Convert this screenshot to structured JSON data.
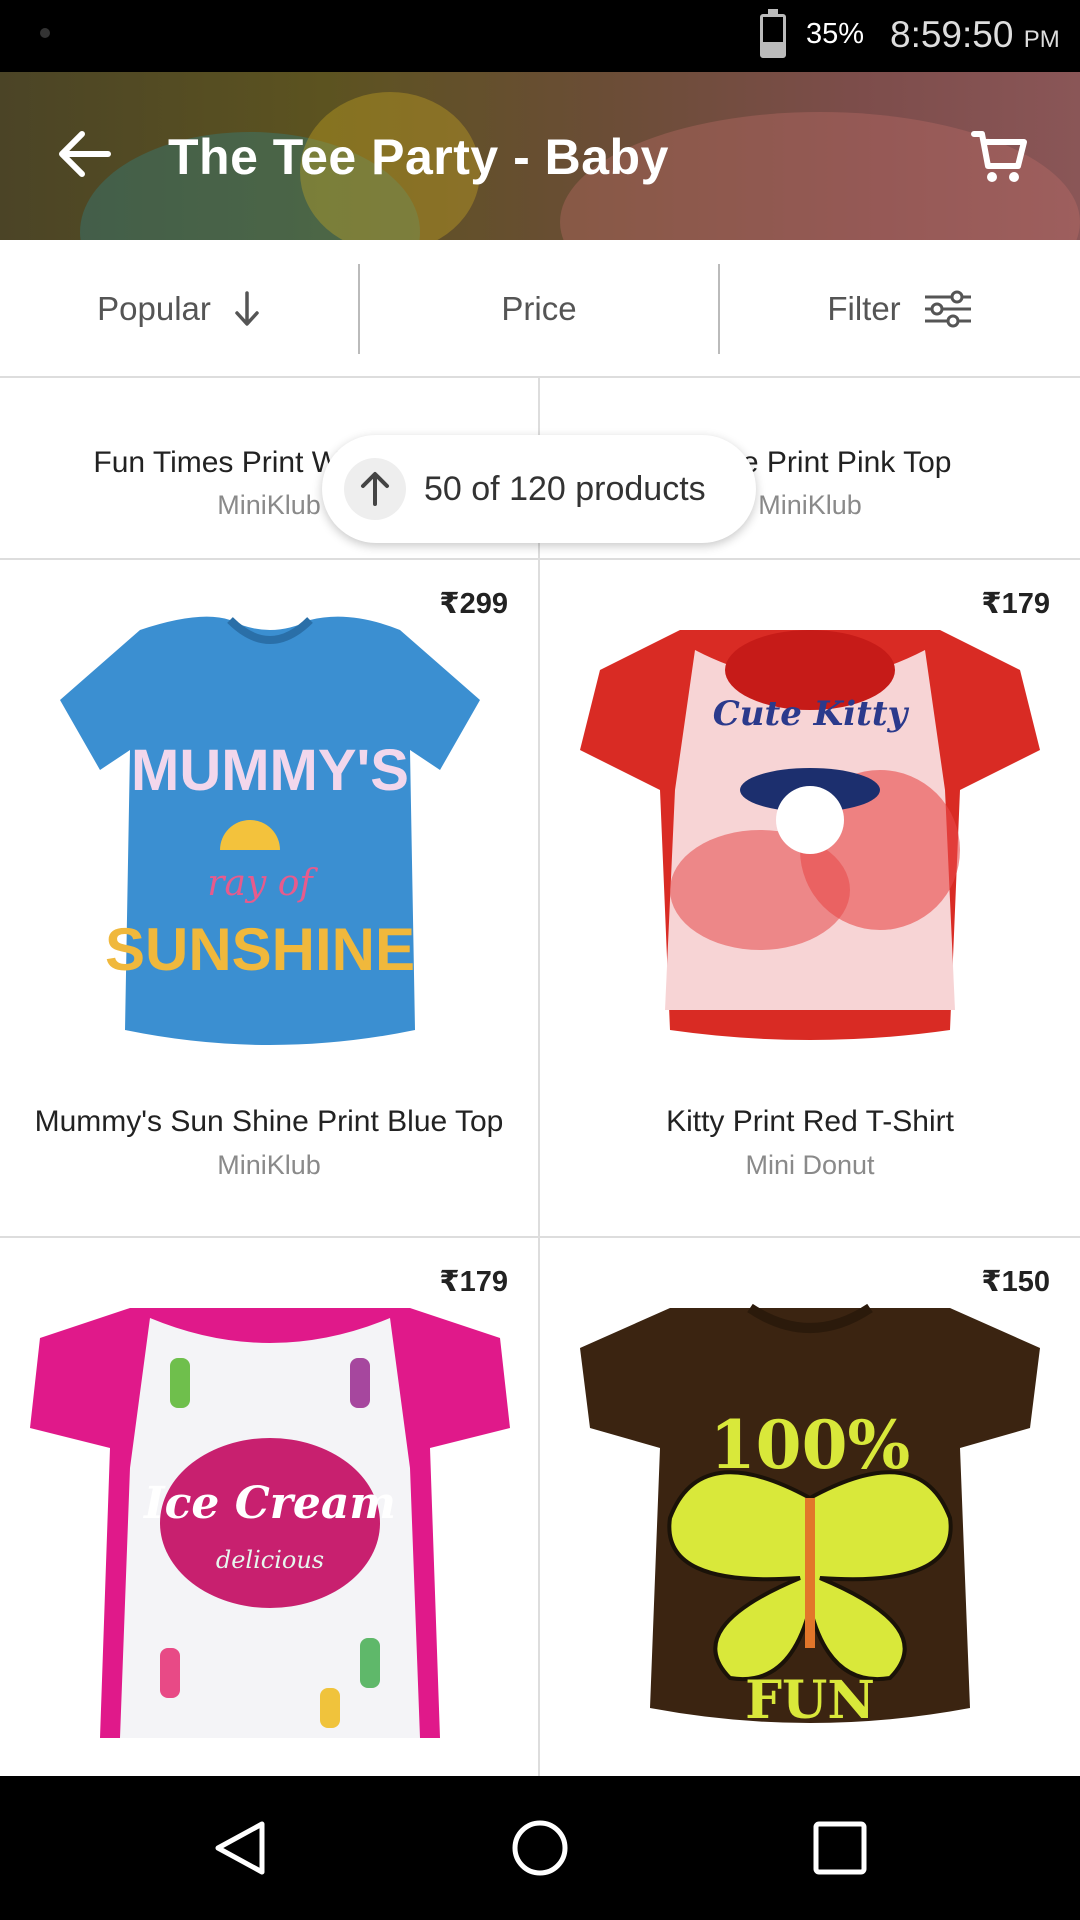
{
  "status_bar": {
    "battery_percent": "35%",
    "time": "8:59:50",
    "ampm": "PM"
  },
  "header": {
    "title": "The Tee Party - Baby",
    "back_icon": "arrow-left-icon",
    "cart_icon": "cart-icon"
  },
  "sort_bar": {
    "popular_label": "Popular",
    "price_label": "Price",
    "filter_label": "Filter"
  },
  "scroll_pill": {
    "text": "50 of 120 products",
    "icon": "arrow-up-icon"
  },
  "products": [
    {
      "name": "Fun Times Print White Top",
      "brand": "MiniKlub",
      "price": ""
    },
    {
      "name": "Nature Print Pink Top",
      "brand": "MiniKlub",
      "price": ""
    },
    {
      "name": "Mummy's Sun Shine Print Blue Top",
      "brand": "MiniKlub",
      "price": "₹299",
      "image": {
        "color": "#3b8fd1",
        "text1": "MUMMY'S",
        "text2": "ray of",
        "text3": "SUNSHINE"
      }
    },
    {
      "name": "Kitty Print Red T-Shirt",
      "brand": "Mini Donut",
      "price": "₹179",
      "image": {
        "color": "#d92b24",
        "text1": "Cute Kitty"
      }
    },
    {
      "name": "",
      "brand": "",
      "price": "₹179",
      "image": {
        "color": "#e0198a",
        "text1": "Ice Cream",
        "text2": "delicious"
      }
    },
    {
      "name": "",
      "brand": "",
      "price": "₹150",
      "image": {
        "color": "#3b2411",
        "text1": "100%",
        "text2": "FUN"
      }
    }
  ],
  "nav_bar": {
    "back": "triangle-back-icon",
    "home": "circle-home-icon",
    "recents": "square-recents-icon"
  }
}
